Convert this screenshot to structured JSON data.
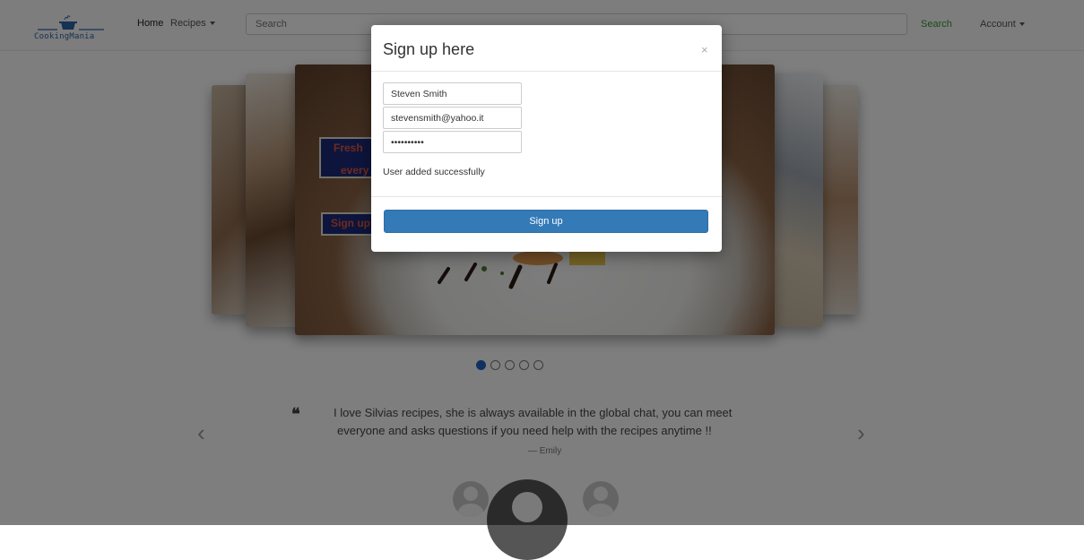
{
  "nav": {
    "logo_text": "CookingMania",
    "home": "Home",
    "recipes": "Recipes",
    "search_placeholder": "Search",
    "search_button": "Search",
    "account": "Account"
  },
  "carousel": {
    "slide_text_1": "Fresh",
    "slide_text_2": "every",
    "slide_button": "Sign up",
    "dot_count": 5,
    "active_dot": 1
  },
  "testimonial": {
    "quote_mark": "❝",
    "line1": "I love Silvias recipes, she is always available in the global chat, you can meet",
    "line2": "everyone and asks questions if you need help with the recipes anytime !!",
    "author": "— Emily",
    "prev_arrow": "‹",
    "next_arrow": "›"
  },
  "modal": {
    "title": "Sign up here",
    "close": "×",
    "name_value": "Steven Smith",
    "email_value": "stevensmith@yahoo.it",
    "password_value": "••••••••••",
    "status": "User added successfully",
    "submit": "Sign up"
  },
  "colors": {
    "primary": "#337ab7",
    "search_green": "#2e9a2e",
    "logo_blue": "#2c64a8"
  }
}
